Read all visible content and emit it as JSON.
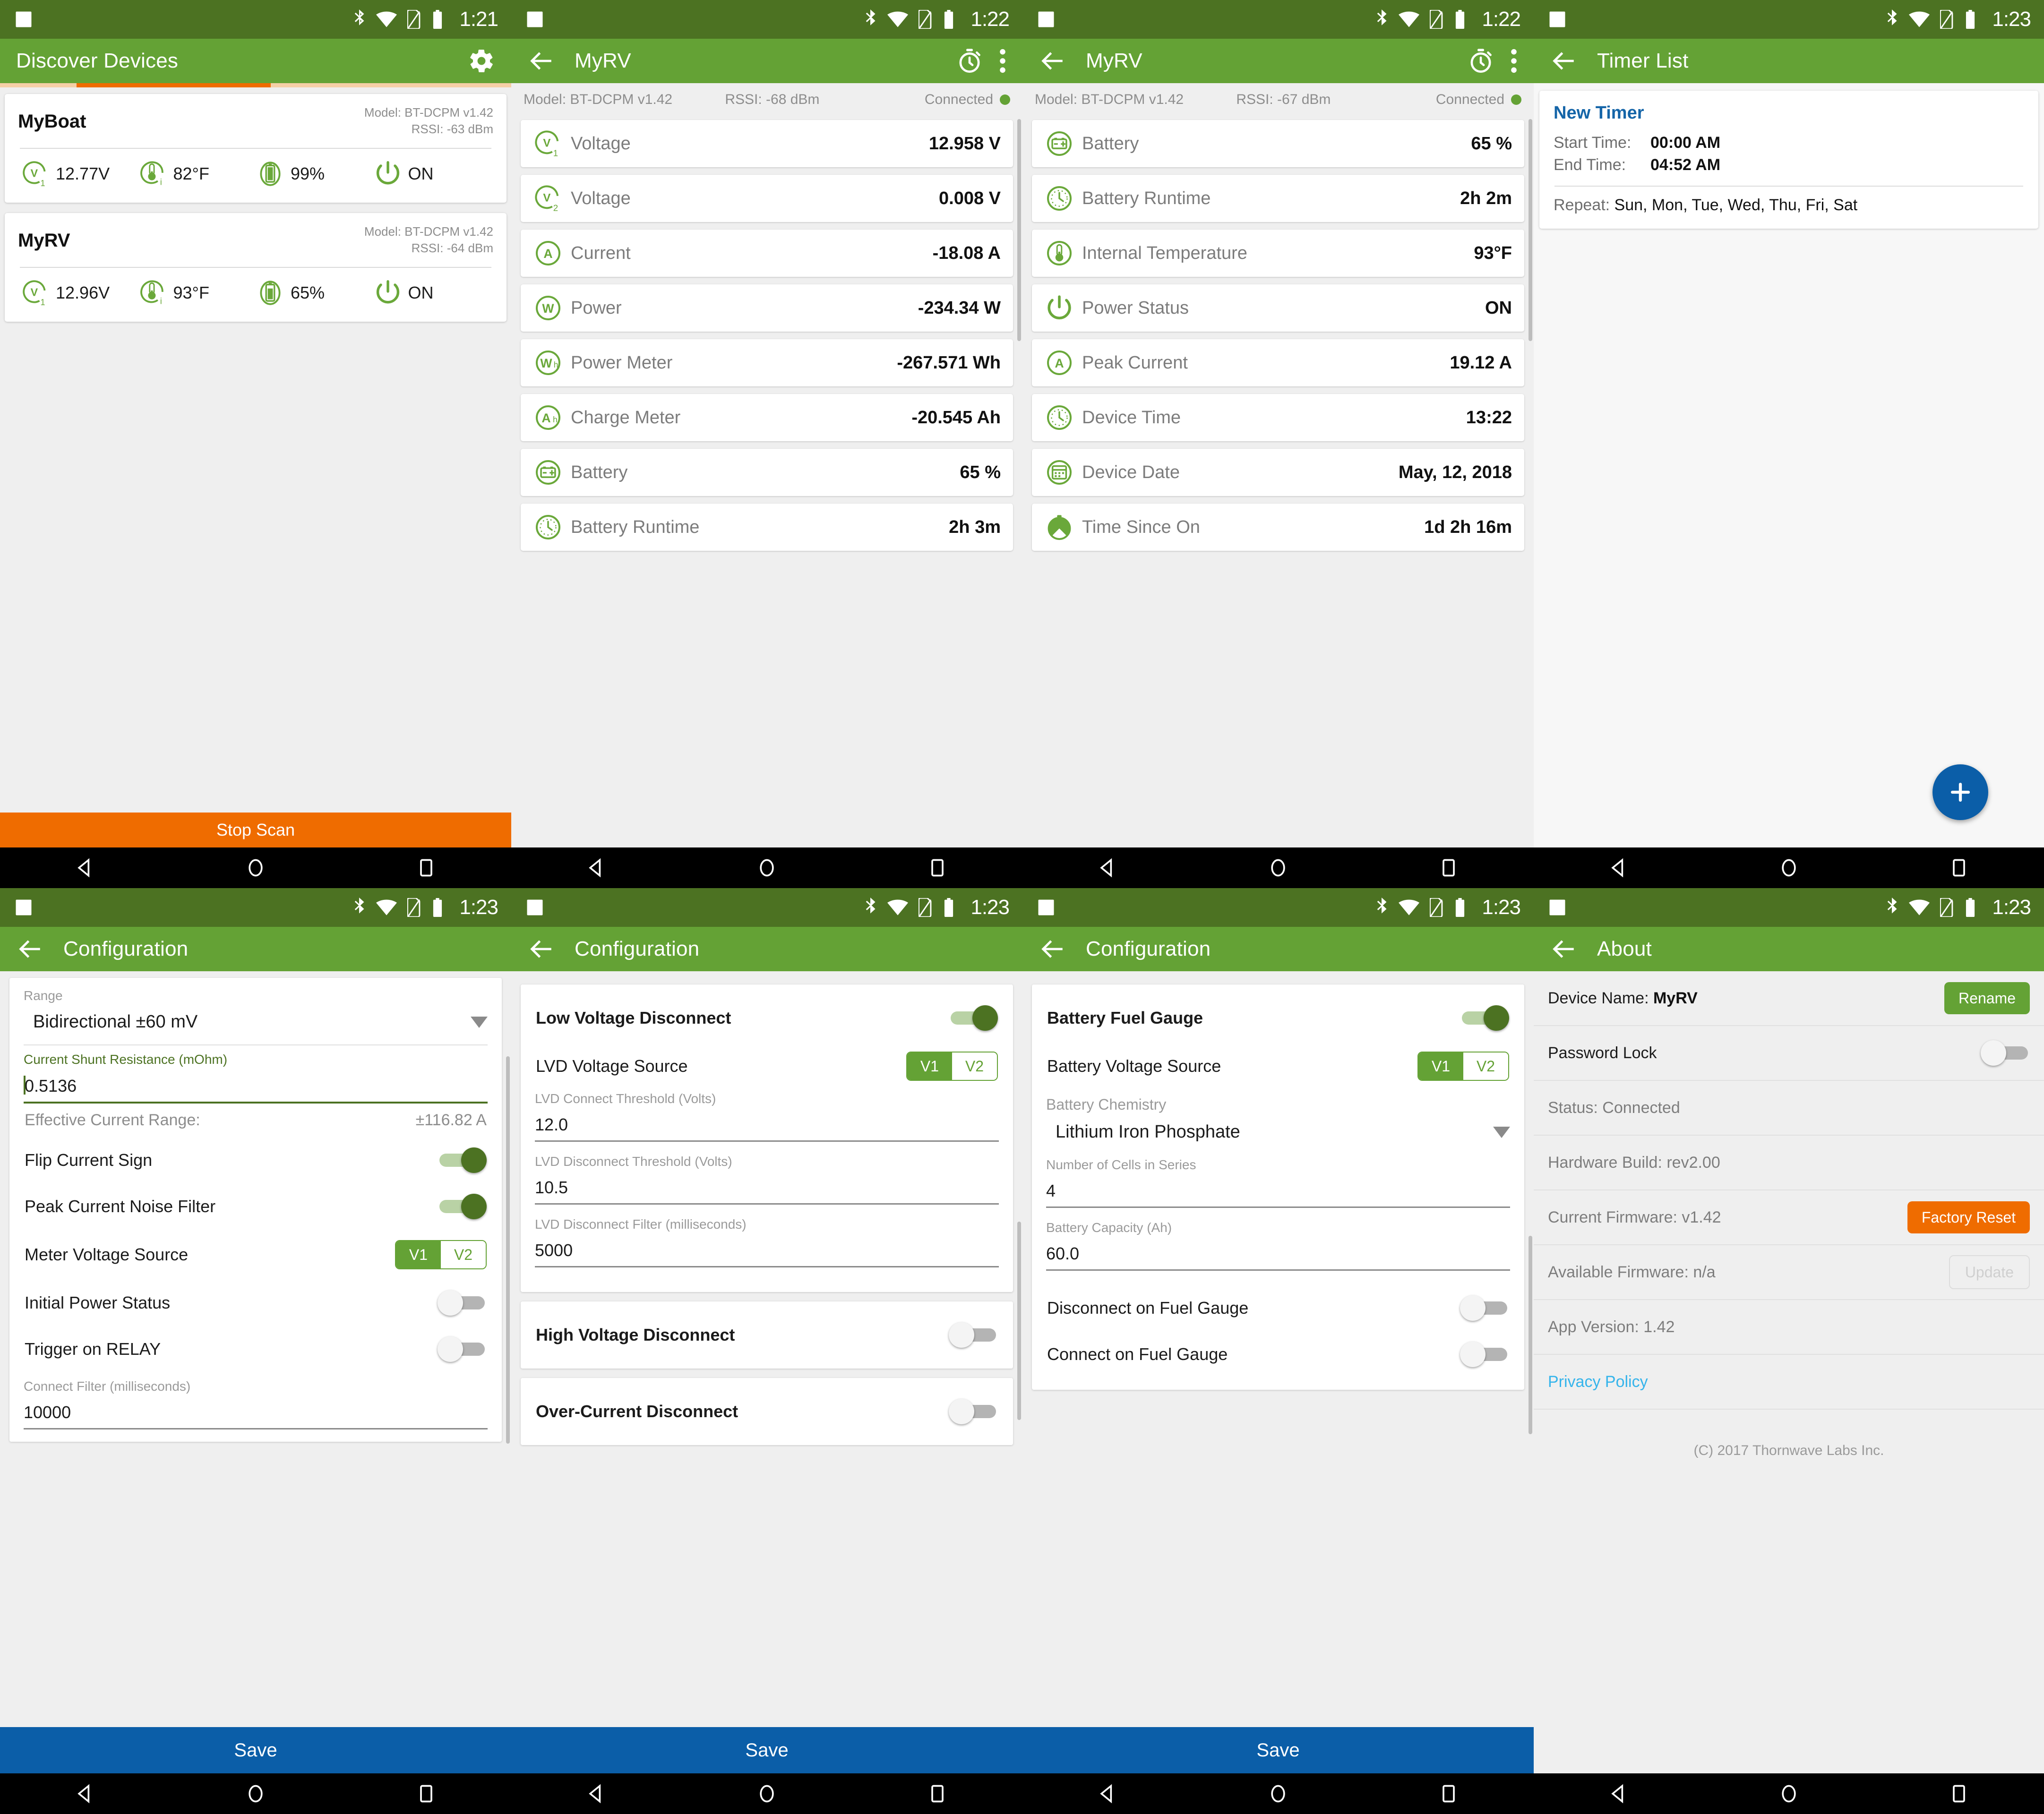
{
  "panels": {
    "discover": {
      "status_time": "1:21",
      "title": "Discover Devices",
      "scan_button": "Stop Scan",
      "devices": [
        {
          "name": "MyBoat",
          "model": "Model: BT-DCPM v1.42",
          "rssi": "RSSI: -63 dBm",
          "voltage": "12.77V",
          "temperature": "82°F",
          "battery": "99%",
          "power": "ON"
        },
        {
          "name": "MyRV",
          "model": "Model: BT-DCPM v1.42",
          "rssi": "RSSI: -64 dBm",
          "voltage": "12.96V",
          "temperature": "93°F",
          "battery": "65%",
          "power": "ON"
        }
      ]
    },
    "device_a": {
      "status_time": "1:22",
      "title": "MyRV",
      "model": "Model: BT-DCPM v1.42",
      "rssi": "RSSI: -68 dBm",
      "connection": "Connected",
      "rows": [
        {
          "icon": "voltage-1-icon",
          "label": "Voltage",
          "value": "12.958 V"
        },
        {
          "icon": "voltage-2-icon",
          "label": "Voltage",
          "value": "0.008 V"
        },
        {
          "icon": "current-icon",
          "label": "Current",
          "value": "-18.08 A"
        },
        {
          "icon": "power-icon",
          "label": "Power",
          "value": "-234.34 W"
        },
        {
          "icon": "power-meter-icon",
          "label": "Power Meter",
          "value": "-267.571 Wh"
        },
        {
          "icon": "charge-meter-icon",
          "label": "Charge Meter",
          "value": "-20.545 Ah"
        },
        {
          "icon": "battery-icon",
          "label": "Battery",
          "value": "65 %"
        },
        {
          "icon": "clock-icon",
          "label": "Battery Runtime",
          "value": "2h 3m"
        }
      ]
    },
    "device_b": {
      "status_time": "1:22",
      "title": "MyRV",
      "model": "Model: BT-DCPM v1.42",
      "rssi": "RSSI: -67 dBm",
      "connection": "Connected",
      "rows": [
        {
          "icon": "battery-icon",
          "label": "Battery",
          "value": "65 %"
        },
        {
          "icon": "clock-icon",
          "label": "Battery Runtime",
          "value": "2h 2m"
        },
        {
          "icon": "thermometer-icon",
          "label": "Internal Temperature",
          "value": "93°F"
        },
        {
          "icon": "power-status-icon",
          "label": "Power Status",
          "value": "ON"
        },
        {
          "icon": "current-icon",
          "label": "Peak Current",
          "value": "19.12 A"
        },
        {
          "icon": "clock-icon",
          "label": "Device Time",
          "value": "13:22"
        },
        {
          "icon": "calendar-icon",
          "label": "Device Date",
          "value": "May, 12, 2018"
        },
        {
          "icon": "stopwatch-icon",
          "label": "Time Since On",
          "value": "1d 2h 16m"
        }
      ]
    },
    "timers": {
      "status_time": "1:23",
      "title": "Timer List",
      "timer": {
        "name": "New Timer",
        "start_label": "Start Time:",
        "start_value": "00:00 AM",
        "end_label": "End Time:",
        "end_value": "04:52 AM",
        "repeat_label": "Repeat:",
        "repeat_value": "Sun, Mon, Tue, Wed, Thu, Fri, Sat"
      },
      "add_button": "add-timer"
    },
    "config_general": {
      "status_time": "1:23",
      "title": "Configuration",
      "range_label": "Range",
      "range_value": "Bidirectional ±60 mV",
      "shunt_label": "Current Shunt Resistance (mOhm)",
      "shunt_value": "0.5136",
      "eff_range_label": "Effective Current Range:",
      "eff_range_value": "±116.82 A",
      "flip_current_sign": "Flip Current Sign",
      "peak_current_noise_filter": "Peak Current Noise Filter",
      "meter_voltage_source": "Meter Voltage Source",
      "seg_v1": "V1",
      "seg_v2": "V2",
      "initial_power_status": "Initial Power Status",
      "trigger_on_relay": "Trigger on RELAY",
      "connect_filter_label": "Connect Filter (milliseconds)",
      "connect_filter_value": "10000",
      "save": "Save"
    },
    "config_lvd": {
      "status_time": "1:23",
      "title": "Configuration",
      "lvd_title": "Low Voltage Disconnect",
      "lvd_source_label": "LVD Voltage Source",
      "seg_v1": "V1",
      "seg_v2": "V2",
      "connect_threshold_label": "LVD Connect Threshold (Volts)",
      "connect_threshold_value": "12.0",
      "disconnect_threshold_label": "LVD Disconnect Threshold (Volts)",
      "disconnect_threshold_value": "10.5",
      "disconnect_filter_label": "LVD Disconnect Filter (milliseconds)",
      "disconnect_filter_value": "5000",
      "hvd_title": "High Voltage Disconnect",
      "ocd_title": "Over-Current Disconnect",
      "save": "Save"
    },
    "config_fuel": {
      "status_time": "1:23",
      "title": "Configuration",
      "fuel_title": "Battery Fuel Gauge",
      "battery_source_label": "Battery Voltage Source",
      "seg_v1": "V1",
      "seg_v2": "V2",
      "chemistry_label": "Battery Chemistry",
      "chemistry_value": "Lithium Iron Phosphate",
      "cells_label": "Number of Cells in Series",
      "cells_value": "4",
      "capacity_label": "Battery Capacity (Ah)",
      "capacity_value": "60.0",
      "disconnect_on_fuel_gauge": "Disconnect on Fuel Gauge",
      "connect_on_fuel_gauge": "Connect on Fuel Gauge",
      "save": "Save"
    },
    "about": {
      "status_time": "1:23",
      "title": "About",
      "device_name_label": "Device Name:",
      "device_name_value": "MyRV",
      "rename_button": "Rename",
      "password_lock": "Password Lock",
      "status": "Status: Connected",
      "hardware_build": "Hardware Build: rev2.00",
      "current_firmware": "Current Firmware: v1.42",
      "factory_reset_button": "Factory Reset",
      "available_firmware": "Available Firmware: n/a",
      "update_button": "Update",
      "app_version": "App Version: 1.42",
      "privacy_policy": "Privacy Policy",
      "copyright": "(C) 2017 Thornwave Labs Inc."
    }
  },
  "colors": {
    "app_green": "#64a235",
    "status_green": "#4c7222",
    "accent_orange": "#ef6c00",
    "accent_blue": "#0b5ea8",
    "link_blue": "#35b4eb",
    "timer_blue": "#1565a8"
  }
}
